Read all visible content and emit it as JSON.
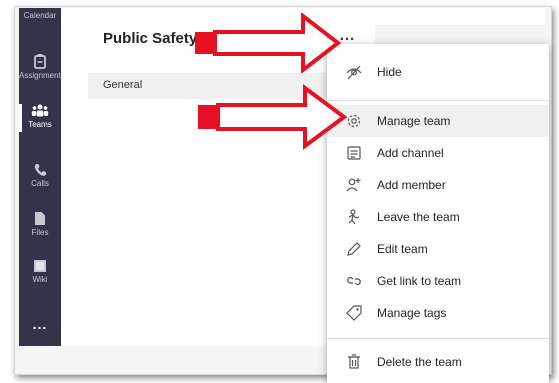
{
  "rail": {
    "items": [
      {
        "label": "Calendar",
        "icon": "calendar-icon"
      },
      {
        "label": "Assignments",
        "icon": "assignments-icon"
      },
      {
        "label": "Teams",
        "icon": "teams-icon"
      },
      {
        "label": "Calls",
        "icon": "calls-icon"
      },
      {
        "label": "Files",
        "icon": "files-icon"
      },
      {
        "label": "Wiki",
        "icon": "wiki-icon"
      }
    ],
    "more": "..."
  },
  "team": {
    "title": "Public Safety I - Section 2",
    "more": "…"
  },
  "channels": [
    {
      "label": "General"
    }
  ],
  "menu": {
    "items": [
      {
        "label": "Hide",
        "icon": "hide-icon"
      },
      {
        "label": "Manage team",
        "icon": "gear-icon"
      },
      {
        "label": "Add channel",
        "icon": "channel-icon"
      },
      {
        "label": "Add member",
        "icon": "add-member-icon"
      },
      {
        "label": "Leave the team",
        "icon": "leave-icon"
      },
      {
        "label": "Edit team",
        "icon": "pencil-icon"
      },
      {
        "label": "Get link to team",
        "icon": "link-icon"
      },
      {
        "label": "Manage tags",
        "icon": "tag-icon"
      },
      {
        "label": "Delete the team",
        "icon": "trash-icon"
      }
    ]
  },
  "colors": {
    "rail": "#33344a",
    "arrow_fill": "#ffffff",
    "arrow_stroke": "#e81123"
  }
}
